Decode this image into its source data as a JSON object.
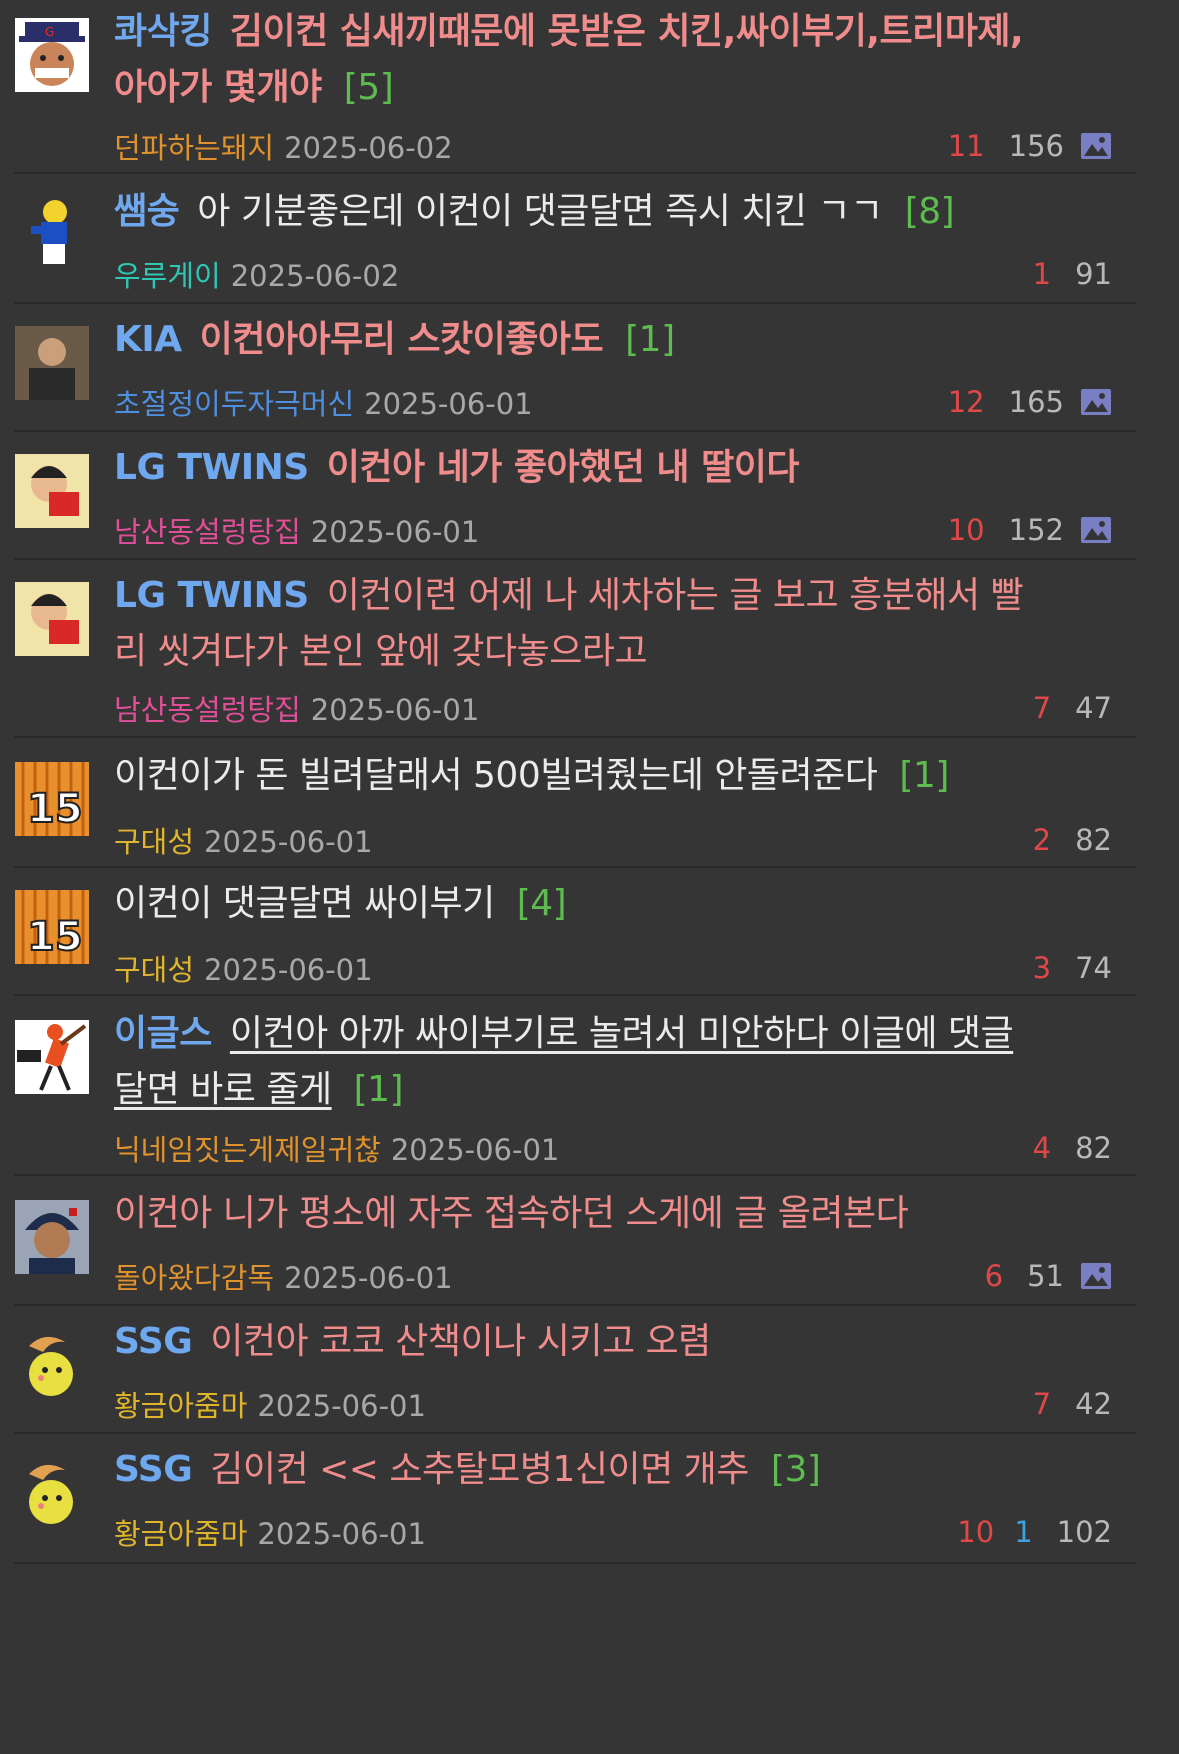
{
  "posts": [
    {
      "category": "콰삭킹",
      "title": "김이컨 십새끼때문에 못받은 치킨,싸이부기,트리마제,아아가 몇개야",
      "title_line1": "김이컨 십새끼때문에 못받은 치킨,싸이부기,트리마제,",
      "title_line2": "아아가 몇개야",
      "comments": "[5]",
      "author": "던파하는돼지",
      "date": "2025-06-02",
      "recommend": "11",
      "views": "156",
      "has_image": true,
      "avatar_icon": "cartoon-face-avatar-icon"
    },
    {
      "category": "쌤숭",
      "title": "아 기분좋은데 이컨이 댓글달면 즉시 치킨 ㄱㄱ",
      "comments": "[8]",
      "author": "우루게이",
      "date": "2025-06-02",
      "recommend": "1",
      "views": "91",
      "has_image": false,
      "avatar_icon": "football-player-avatar-icon"
    },
    {
      "category": "KIA",
      "title": "이컨아아무리 스캇이좋아도",
      "comments": "[1]",
      "author": "초절정이두자극머신",
      "date": "2025-06-01",
      "recommend": "12",
      "views": "165",
      "has_image": true,
      "avatar_icon": "photo-avatar-icon"
    },
    {
      "category": "LG TWINS",
      "title": "이컨아 네가 좋아했던 내 딸이다",
      "comments": "",
      "author": "남산동설렁탕집",
      "date": "2025-06-01",
      "recommend": "10",
      "views": "152",
      "has_image": true,
      "avatar_icon": "cartoon-boy-avatar-icon"
    },
    {
      "category": "LG TWINS",
      "title": "이컨이련 어제 나 세차하는 글 보고 흥분해서 빨리 씻겨다가 본인 앞에 갖다놓으라고",
      "title_line1": "이컨이련 어제 나 세차하는 글 보고 흥분해서 빨",
      "title_line2": "리 씻겨다가 본인 앞에 갖다놓으라고",
      "comments": "",
      "author": "남산동설렁탕집",
      "date": "2025-06-01",
      "recommend": "7",
      "views": "47",
      "has_image": false,
      "avatar_icon": "cartoon-boy-avatar-icon"
    },
    {
      "category": "",
      "title": "이컨이가 돈 빌려달래서 500빌려줬는데 안돌려준다",
      "comments": "[1]",
      "author": "구대성",
      "date": "2025-06-01",
      "recommend": "2",
      "views": "82",
      "has_image": false,
      "avatar_icon": "jersey-15-avatar-icon"
    },
    {
      "category": "",
      "title": "이컨이 댓글달면 싸이부기",
      "comments": "[4]",
      "author": "구대성",
      "date": "2025-06-01",
      "recommend": "3",
      "views": "74",
      "has_image": false,
      "avatar_icon": "jersey-15-avatar-icon"
    },
    {
      "category": "이글스",
      "title": "이컨아 아까 싸이부기로 놀려서 미안하다 이글에 댓글 달면 바로 줄게",
      "title_line1": "이컨아 아까 싸이부기로 놀려서 미안하다 이글에 댓글",
      "title_line2": "달면 바로 줄게",
      "comments": "[1]",
      "author": "닉네임짓는게제일귀찮",
      "date": "2025-06-01",
      "recommend": "4",
      "views": "82",
      "has_image": false,
      "avatar_icon": "baseball-batter-avatar-icon"
    },
    {
      "category": "",
      "title": "이컨아 니가 평소에 자주 접속하던 스게에 글 올려본다",
      "comments": "",
      "author": "돌아왔다감독",
      "date": "2025-06-01",
      "recommend": "6",
      "views": "51",
      "has_image": true,
      "avatar_icon": "player-photo-avatar-icon"
    },
    {
      "category": "SSG",
      "title": "이컨아 코코 산책이나 시키고 오렴",
      "comments": "",
      "author": "황금아줌마",
      "date": "2025-06-01",
      "recommend": "7",
      "views": "42",
      "has_image": false,
      "avatar_icon": "yellow-creature-avatar-icon"
    },
    {
      "category": "SSG",
      "title": "김이컨 << 소추탈모병1신이면 개추",
      "comments": "[3]",
      "author": "황금아줌마",
      "date": "2025-06-01",
      "recommend": "10",
      "recommend2": "1",
      "views": "102",
      "has_image": false,
      "avatar_icon": "yellow-creature-avatar-icon"
    }
  ],
  "colors": {
    "background": "#353535",
    "category": "#6fa8ee",
    "title_pink": "#f08c8c",
    "comment_count": "#5dbb4f",
    "recommend": "#e04848",
    "views": "#b8b8b8",
    "date": "#a8a8a8"
  }
}
